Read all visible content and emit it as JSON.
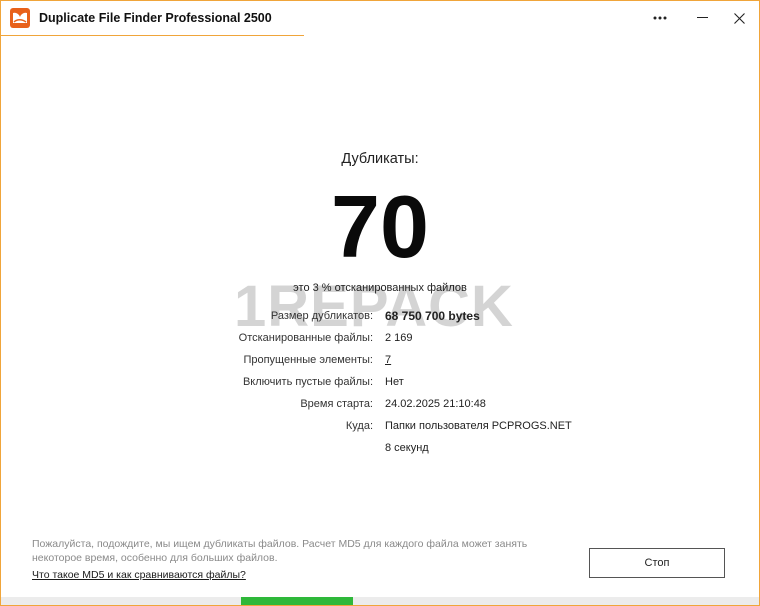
{
  "window": {
    "title": "Duplicate File Finder Professional 2500",
    "accent_color": "#f0a53a",
    "icon": "app-logo-icon"
  },
  "titlebar": {
    "more_icon": "more-dots-icon",
    "minimize_icon": "minimize-icon",
    "close_icon": "close-icon"
  },
  "main": {
    "duplicates_label": "Дубликаты:",
    "duplicates_count": "70",
    "percent_text": "это 3 % отсканированных файлов",
    "watermark": "1REPACK"
  },
  "stats": [
    {
      "label": "Размер дубликатов:",
      "value": "68 750 700 bytes"
    },
    {
      "label": "Отсканированные файлы:",
      "value": "2 169"
    },
    {
      "label": "Пропущенные элементы:",
      "value": "7"
    },
    {
      "label": "Включить пустые файлы:",
      "value": "Нет"
    },
    {
      "label": "Время старта:",
      "value": "24.02.2025 21:10:48"
    },
    {
      "label": "Куда:",
      "value": "Папки пользователя PCPROGS.NET"
    },
    {
      "label": "",
      "value": "8 секунд"
    }
  ],
  "footer": {
    "message": "Пожалуйста, подождите, мы ищем дубликаты файлов. Расчет MD5 для каждого файла может занять некоторое время, особенно для больших файлов.",
    "link": "Что такое MD5 и как сравниваются файлы?",
    "stop_label": "Стоп"
  },
  "progress": {
    "color": "#2fb83a"
  }
}
